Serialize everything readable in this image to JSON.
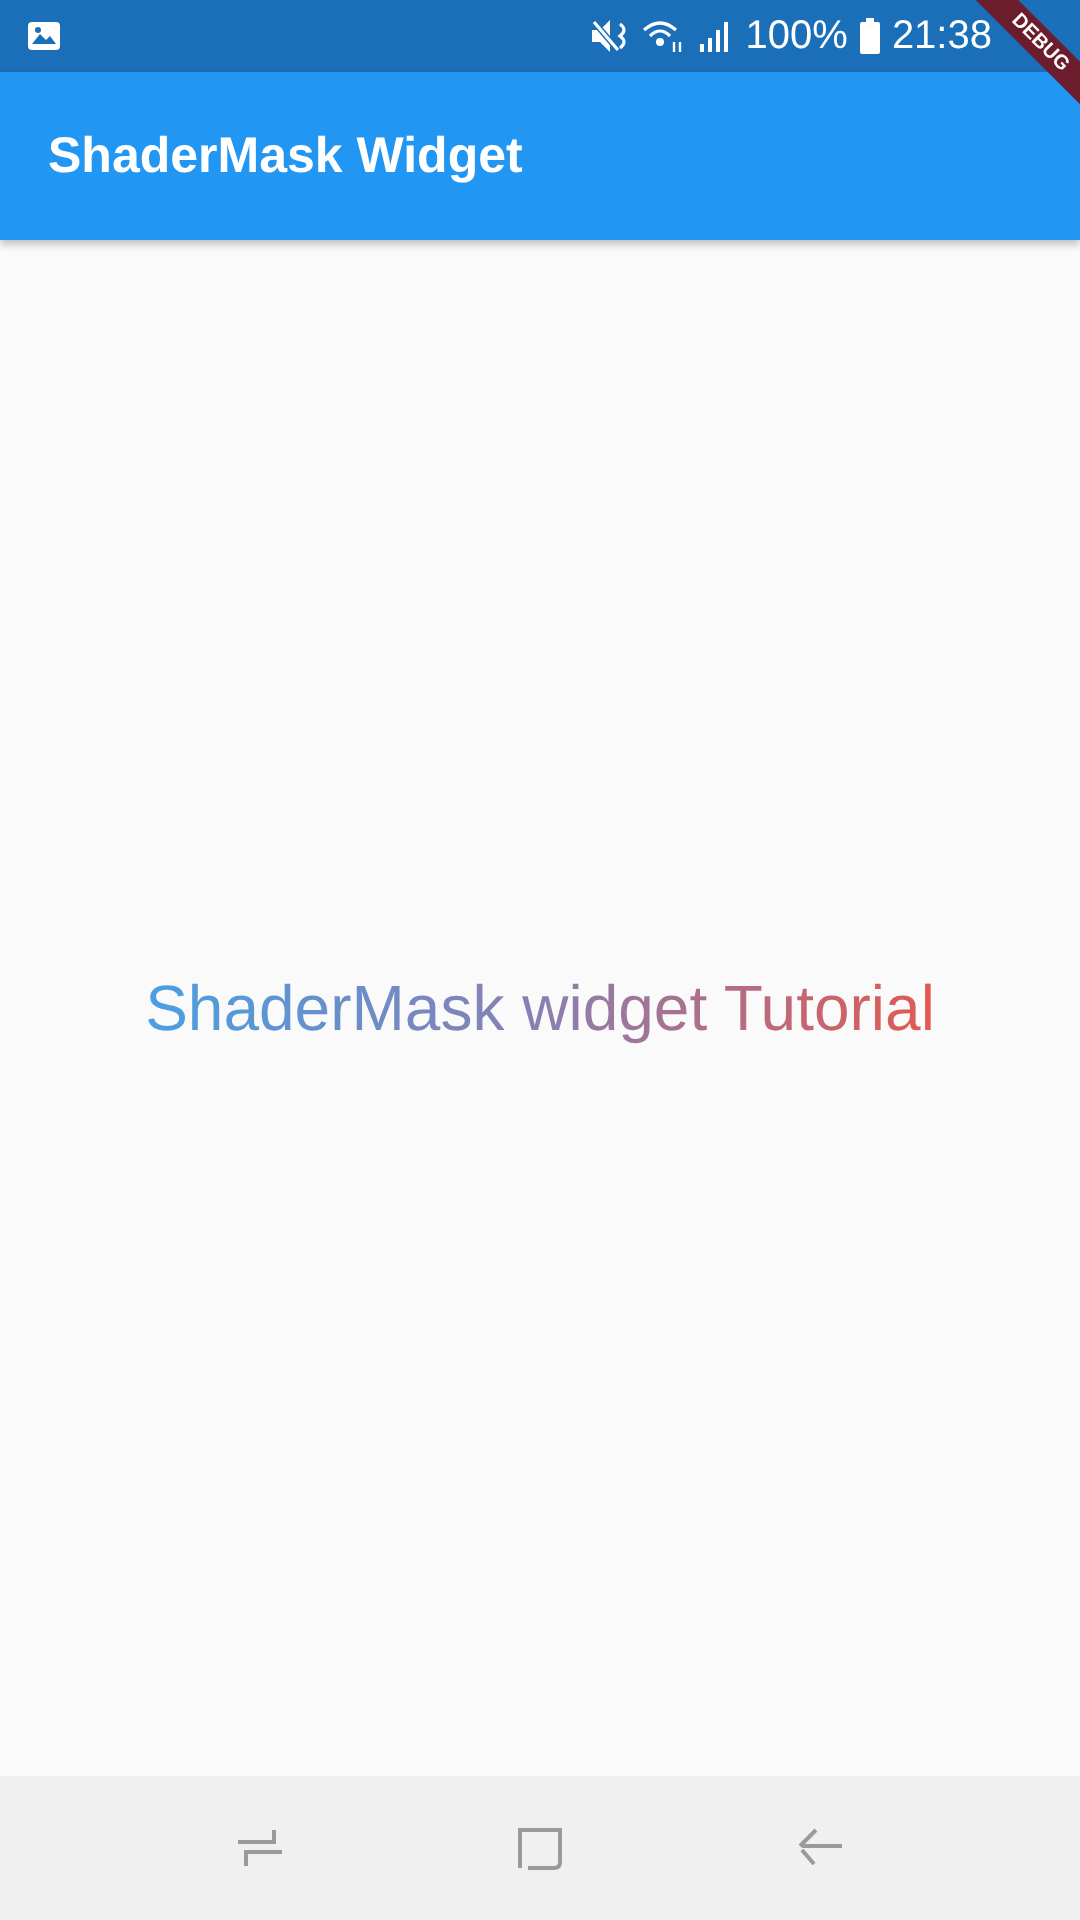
{
  "status_bar": {
    "battery": "100%",
    "time": "21:38"
  },
  "app_bar": {
    "title": "ShaderMask Widget"
  },
  "debug_banner": {
    "label": "DEBUG"
  },
  "body": {
    "text": "ShaderMask widget Tutorial"
  }
}
